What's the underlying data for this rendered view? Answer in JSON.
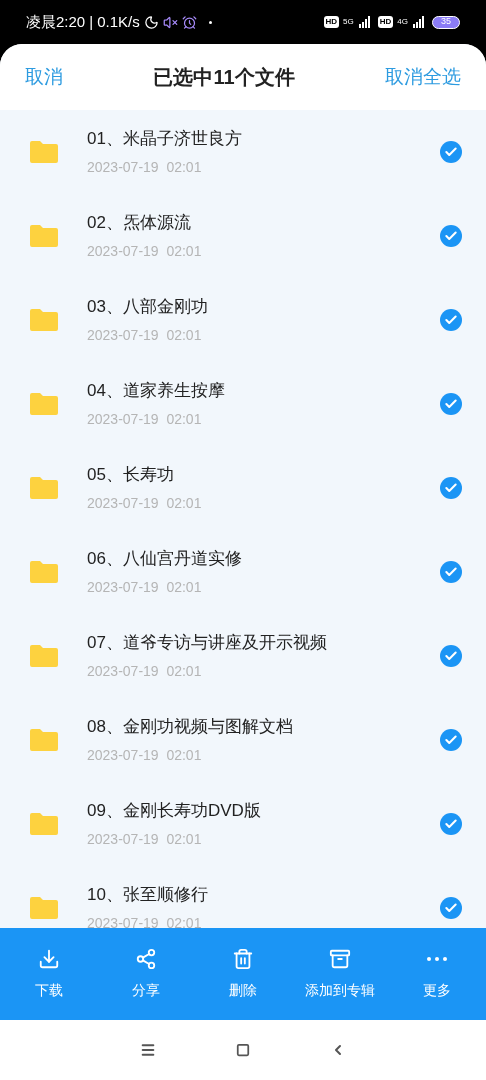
{
  "status_bar": {
    "time": "凌晨2:20",
    "speed": "| 0.1K/s",
    "hd_1": "HD",
    "net_1": "5G",
    "hd_2": "HD",
    "net_2": "4G",
    "battery": "35"
  },
  "header": {
    "cancel": "取消",
    "title": "已选中11个文件",
    "deselect_all": "取消全选"
  },
  "files": [
    {
      "name": "01、米晶子济世良方",
      "date": "2023-07-19  02:01",
      "checked": true
    },
    {
      "name": "02、炁体源流",
      "date": "2023-07-19  02:01",
      "checked": true
    },
    {
      "name": "03、八部金刚功",
      "date": "2023-07-19  02:01",
      "checked": true
    },
    {
      "name": "04、道家养生按摩",
      "date": "2023-07-19  02:01",
      "checked": true
    },
    {
      "name": "05、长寿功",
      "date": "2023-07-19  02:01",
      "checked": true
    },
    {
      "name": "06、八仙宫丹道实修",
      "date": "2023-07-19  02:01",
      "checked": true
    },
    {
      "name": "07、道爷专访与讲座及开示视频",
      "date": "2023-07-19  02:01",
      "checked": true
    },
    {
      "name": "08、金刚功视频与图解文档",
      "date": "2023-07-19  02:01",
      "checked": true
    },
    {
      "name": "09、金刚长寿功DVD版",
      "date": "2023-07-19  02:01",
      "checked": true
    },
    {
      "name": "10、张至顺修行",
      "date": "2023-07-19  02:01",
      "checked": true
    }
  ],
  "toolbar": [
    {
      "kind": "download",
      "label": "下载"
    },
    {
      "kind": "share",
      "label": "分享"
    },
    {
      "kind": "delete",
      "label": "删除"
    },
    {
      "kind": "album",
      "label": "添加到专辑"
    },
    {
      "kind": "more",
      "label": "更多"
    }
  ]
}
